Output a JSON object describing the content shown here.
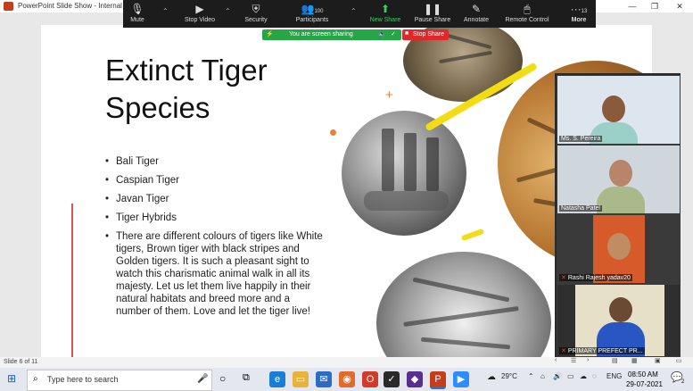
{
  "window": {
    "title": "PowerPoint Slide Show - Internal",
    "minimize_glyph": "—",
    "restore_glyph": "❐",
    "close_glyph": "✕"
  },
  "zoom_toolbar": {
    "buttons": [
      {
        "label": "Mute",
        "icon": "microphone-icon"
      },
      {
        "label": "Stop Video",
        "icon": "video-camera-icon"
      },
      {
        "label": "Security",
        "icon": "shield-icon"
      },
      {
        "label": "Participants",
        "icon": "participants-icon",
        "count": "100"
      },
      {
        "label": "New Share",
        "icon": "share-screen-icon"
      },
      {
        "label": "Pause Share",
        "icon": "pause-icon"
      },
      {
        "label": "Annotate",
        "icon": "pen-icon"
      },
      {
        "label": "Remote Control",
        "icon": "mouse-icon"
      },
      {
        "label": "More",
        "icon": "more-icon",
        "count": "13"
      }
    ],
    "sharing_banner": "You are screen sharing",
    "stop_share_label": "Stop Share",
    "accent_green": "#23d959",
    "stop_red": "#e02828"
  },
  "slide": {
    "title": "Extinct Tiger Species",
    "bullets": [
      "Bali Tiger",
      "Caspian Tiger",
      "Javan Tiger",
      "Tiger Hybrids",
      "There are different colours of tigers like White tigers, Brown tiger with black stripes and Golden tigers. It is such a pleasant sight to watch this charismatic animal walk in all its majesty. Let us let them live happily in their natural habitats and breed more and a number of them. Love and let the tiger live!"
    ],
    "annotation_color": "#f2dc13"
  },
  "participants": [
    {
      "name": "Ms. S. Pereira",
      "muted": false
    },
    {
      "name": "Natasha Patel",
      "muted": false
    },
    {
      "name": "Rashi Rajesh yadav20",
      "muted": true
    },
    {
      "name": "PRIMARY PREFECT PR...",
      "muted": true
    }
  ],
  "statusbar": {
    "slide_counter": "Slide 6 of 11"
  },
  "taskbar": {
    "search_placeholder": "Type here to search",
    "temperature": "29°C",
    "language": "ENG",
    "time": "08:50 AM",
    "date": "29-07-2021",
    "notification_count": "2"
  }
}
